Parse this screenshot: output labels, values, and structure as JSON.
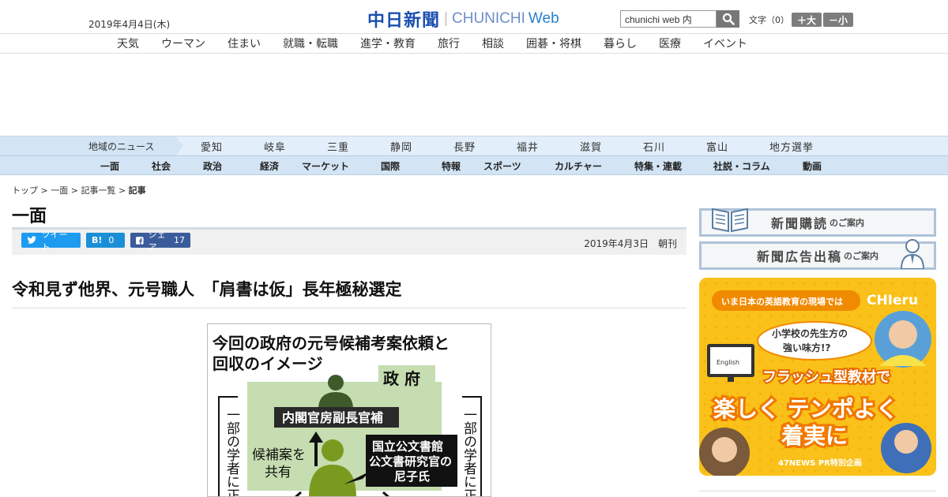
{
  "header": {
    "date": "2019年4月4日(木)",
    "logo_jp": "中日新聞",
    "logo_en": "CHUNICHI",
    "logo_web": "Web",
    "search_value": "chunichi web 内",
    "font_size_label": "文字（0）",
    "font_large": "＋大",
    "font_small": "－小"
  },
  "nav": [
    "天気",
    "ウーマン",
    "住まい",
    "就職・転職",
    "進学・教育",
    "旅行",
    "相談",
    "囲碁・将棋",
    "暮らし",
    "医療",
    "イベント"
  ],
  "region": {
    "label": "地域のニュース",
    "items": [
      "愛知",
      "岐阜",
      "三重",
      "静岡",
      "長野",
      "福井",
      "滋賀",
      "石川",
      "富山",
      "地方選挙"
    ]
  },
  "categories": [
    "一面",
    "社会",
    "政治",
    "経済",
    "マーケット",
    "国際",
    "特報",
    "スポーツ",
    "カルチャー",
    "特集・連載",
    "社説・コラム",
    "動画"
  ],
  "breadcrumb": {
    "items": [
      "トップ",
      "一面",
      "記事一覧"
    ],
    "current": "記事",
    "sep": ">"
  },
  "section_title": "一面",
  "share": {
    "tweet": "ツイート",
    "hatena": "B!",
    "hatena_count": "0",
    "facebook": "シェア",
    "facebook_count": "17"
  },
  "publication": "2019年4月3日　朝刊",
  "article_title": "令和見ず他界、元号職人　「肩書は仮」長年極秘選定",
  "figure": {
    "title_line1": "今回の政府の元号候補考案依頼と",
    "title_line2": "回収のイメージ",
    "gov_label": "政 府",
    "role1": "内閣官房副長官補",
    "share_text_1": "候補案を",
    "share_text_2": "共有",
    "archive_line1": "国立公文書館",
    "archive_line2": "公文書研究官の",
    "archive_line3": "尼子氏",
    "side_left": "一部の学者に正式",
    "side_right": "一部の学者に正式"
  },
  "sidebar": {
    "subscribe_big": "新聞購読",
    "subscribe_small": "のご案内",
    "ads_big": "新聞広告出稿",
    "ads_small": "のご案内",
    "ad": {
      "top_banner": "いま日本の英語教育の現場では",
      "brand": "CHIeru",
      "bubble_1": "小学校の先生方の",
      "bubble_2": "強い味方!?",
      "middle": "フラッシュ型教材で",
      "big_1": "楽しく テンポよく",
      "big_2": "着実に",
      "footer": "47NEWS PR特別企画",
      "screen_text": "English"
    }
  },
  "colors": {
    "logo_blue": "#1a4fb0",
    "region_bg": "#e2eef9",
    "category_bg": "#d3e4f4",
    "twitter": "#1d9bf0",
    "hatena": "#1a8fd6",
    "facebook": "#3b5b9b",
    "ad_yellow": "#f9c11a",
    "ad_orange": "#f08a00"
  }
}
